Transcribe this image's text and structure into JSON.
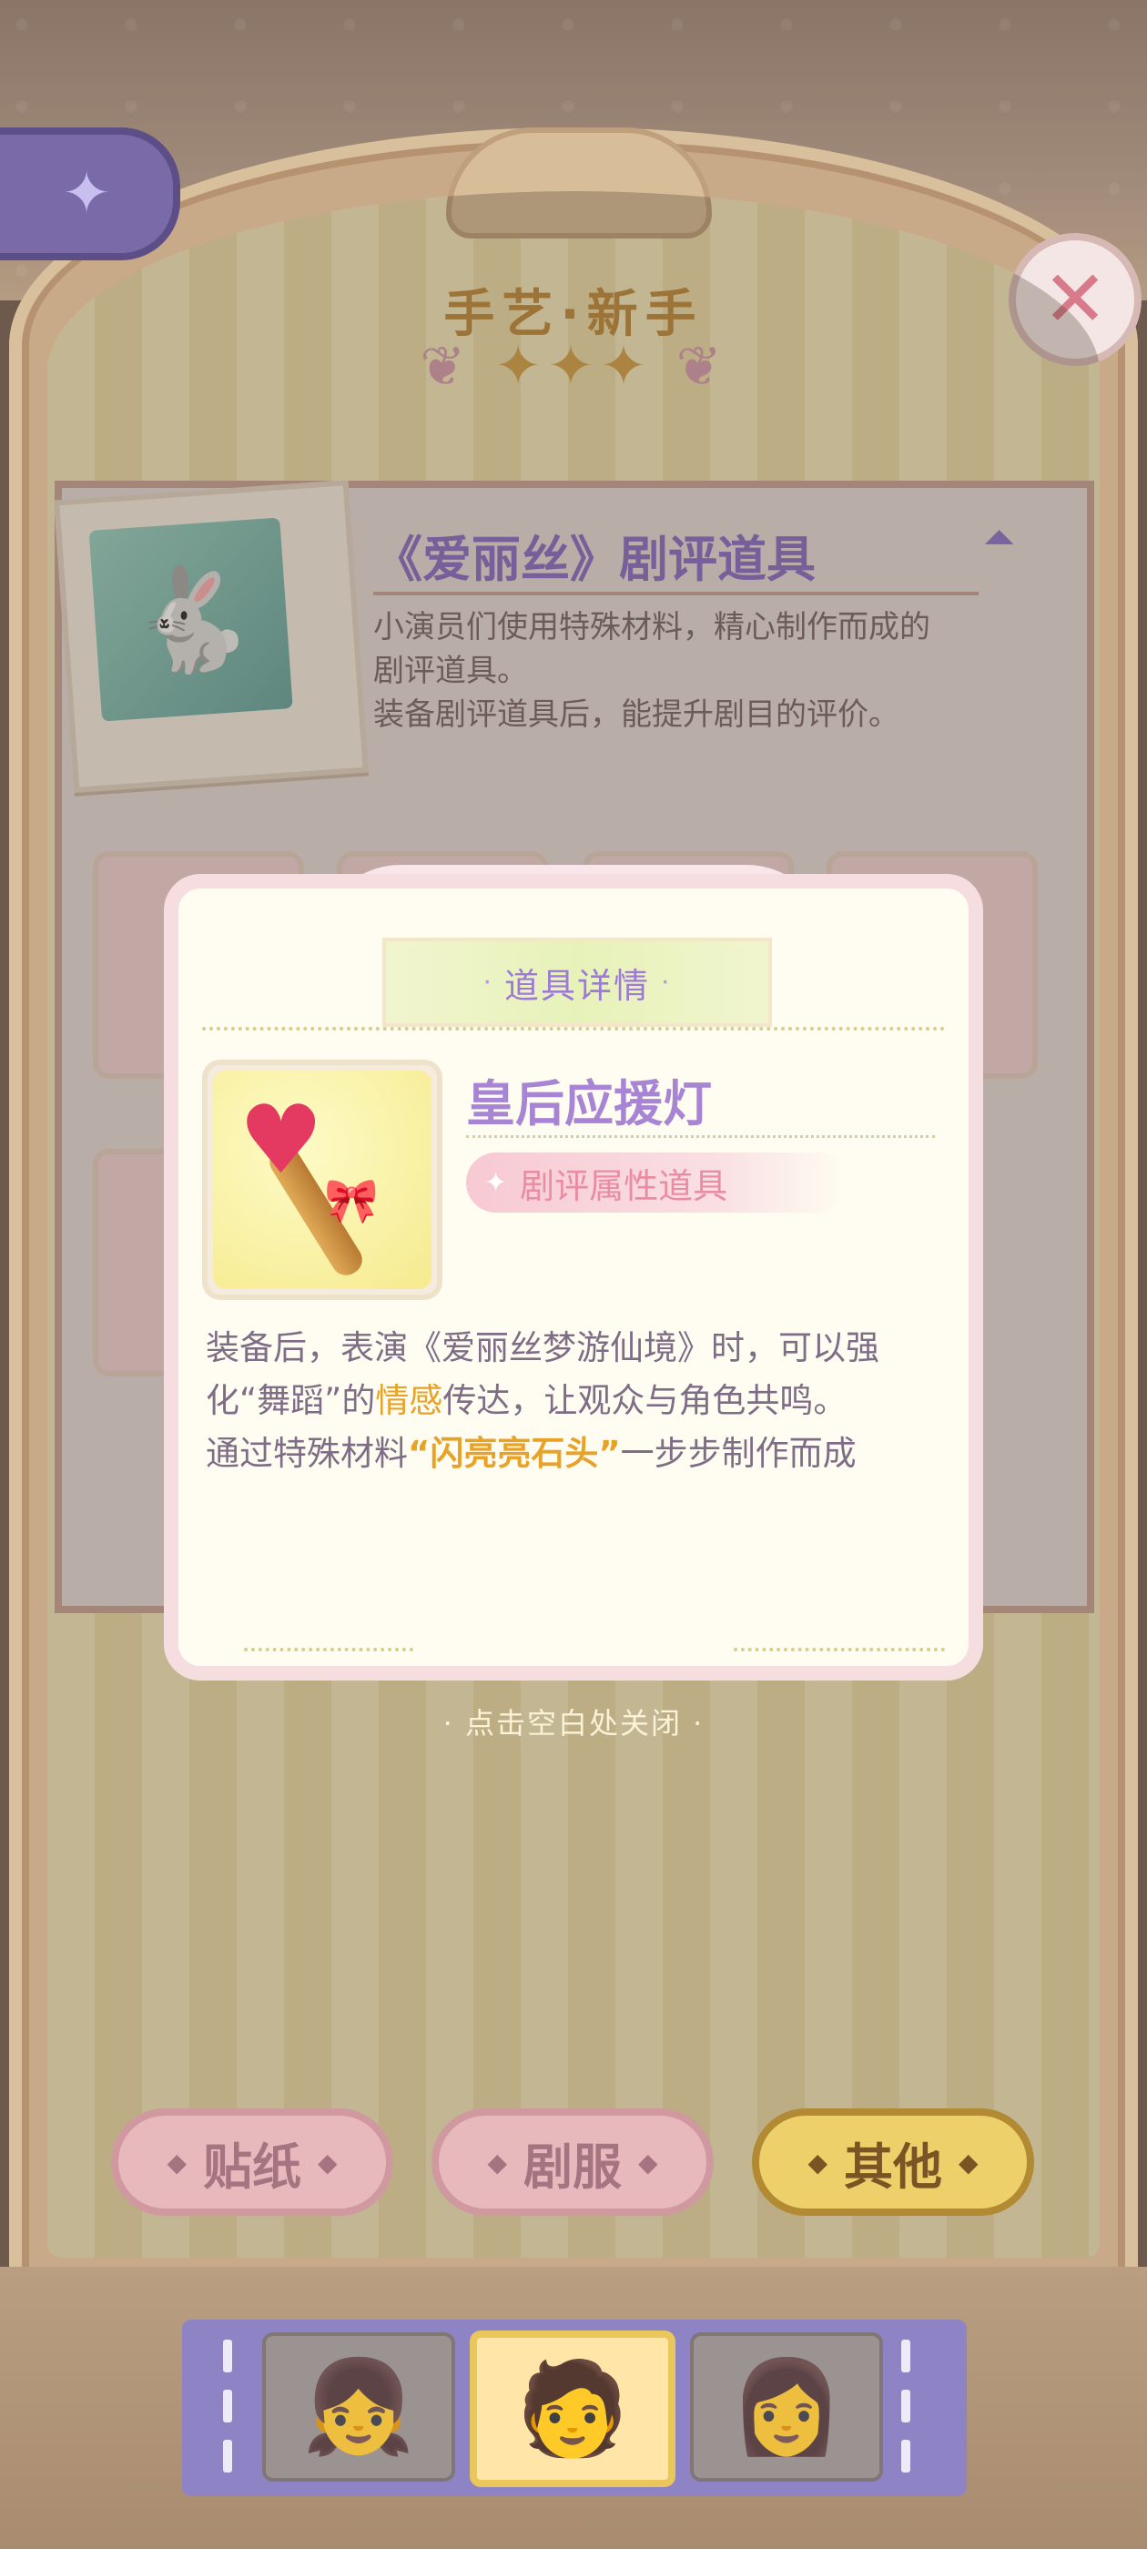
{
  "header": {
    "rank_title": "手艺·新手",
    "stars": "✦✦✦",
    "close_glyph": "✕",
    "side_tab_glyph": "✦"
  },
  "info_card": {
    "title": "《爱丽丝》剧评道具",
    "description": [
      "小演员们使用特殊材料，精心制作而成的",
      "剧评道具。",
      "装备剧评道具后，能提升剧目的评价。"
    ],
    "collapse_icon": "chevron-up-icon"
  },
  "modal": {
    "banner": "道具详情",
    "item_name": "皇后应援灯",
    "item_tag": "剧评属性道具",
    "desc_line1": "装备后，表演《爱丽丝梦游仙境》时，可以强",
    "desc_line2_a": "化“舞蹈”的",
    "desc_line2_hl": "情感",
    "desc_line2_b": "传达，让观众与角色共鸣。",
    "desc_line3_a": "通过特殊材料",
    "desc_line3_hl": "“闪亮亮石头”",
    "desc_line3_b": "一步步制作而成",
    "tap_hint": "· 点击空白处关闭 ·"
  },
  "categories": [
    {
      "label": "贴纸",
      "active": false
    },
    {
      "label": "剧服",
      "active": false
    },
    {
      "label": "其他",
      "active": true
    }
  ],
  "character_bar": {
    "slots": [
      {
        "icon": "character-portrait-1-icon",
        "selected": false
      },
      {
        "icon": "character-portrait-2-icon",
        "selected": true
      },
      {
        "icon": "character-portrait-3-icon",
        "selected": false
      }
    ]
  },
  "colors": {
    "accent_purple": "#a784d4",
    "highlight_orange": "#e7a227",
    "tag_pink": "#ea8da2",
    "active_gold": "#eed06a"
  }
}
